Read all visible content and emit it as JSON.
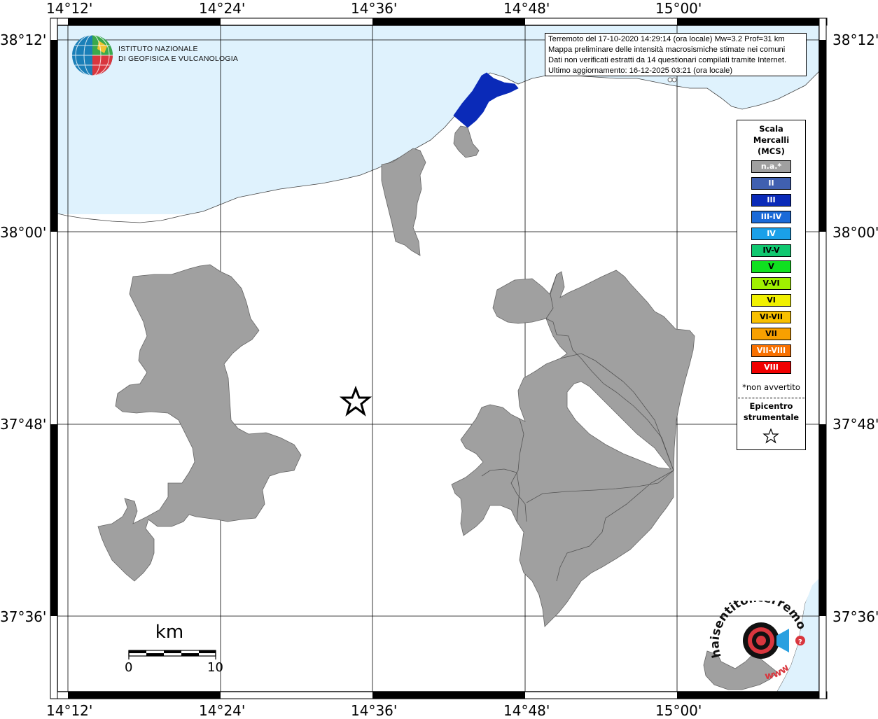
{
  "axes": {
    "lon_labels": [
      "14°12'",
      "14°24'",
      "14°36'",
      "14°48'",
      "15°00'"
    ],
    "lat_labels": [
      "38°12'",
      "38°00'",
      "37°48'",
      "37°36'"
    ]
  },
  "info": {
    "line1": "Terremoto del 17-10-2020 14:29:14 (ora locale) Mw=3.2 Prof=31 km",
    "line2": "Mappa preliminare delle intensità macrosismiche stimate nei comuni",
    "line3": "Dati non verificati estratti da 14 questionari compilati tramite Internet.",
    "line4": "Ultimo aggiornamento: 16-12-2025 03:21 (ora locale)"
  },
  "logo": {
    "line1": "ISTITUTO NAZIONALE",
    "line2": "DI GEOFISICA E VULCANOLOGIA"
  },
  "legend": {
    "title1": "Scala",
    "title2": "Mercalli",
    "title3": "(MCS)",
    "items": [
      {
        "label": "n.a.*",
        "color": "#a0a0a0"
      },
      {
        "label": "II",
        "color": "#4060b0"
      },
      {
        "label": "III",
        "color": "#0a2ab8"
      },
      {
        "label": "III-IV",
        "color": "#1a6ad8"
      },
      {
        "label": "IV",
        "color": "#1aa0e8"
      },
      {
        "label": "IV-V",
        "color": "#10c870"
      },
      {
        "label": "V",
        "color": "#10e020"
      },
      {
        "label": "V-VI",
        "color": "#a0f000"
      },
      {
        "label": "VI",
        "color": "#f0f000"
      },
      {
        "label": "VI-VII",
        "color": "#f8c000"
      },
      {
        "label": "VII",
        "color": "#f8a000"
      },
      {
        "label": "VII-VIII",
        "color": "#f87000"
      },
      {
        "label": "VIII",
        "color": "#f00000"
      }
    ],
    "note": "*non avvertito",
    "epicenter1": "Epicentro",
    "epicenter2": "strumentale"
  },
  "scale": {
    "title": "km",
    "min": "0",
    "max": "10"
  },
  "hsi_logo": {
    "text": "haisentitoilterremoto.it",
    "www": "www"
  },
  "colors": {
    "sea": "#dff2fd",
    "land": "#ffffff",
    "municipality_na": "#a0a0a0",
    "municipality_iii": "#0a2ab8"
  }
}
